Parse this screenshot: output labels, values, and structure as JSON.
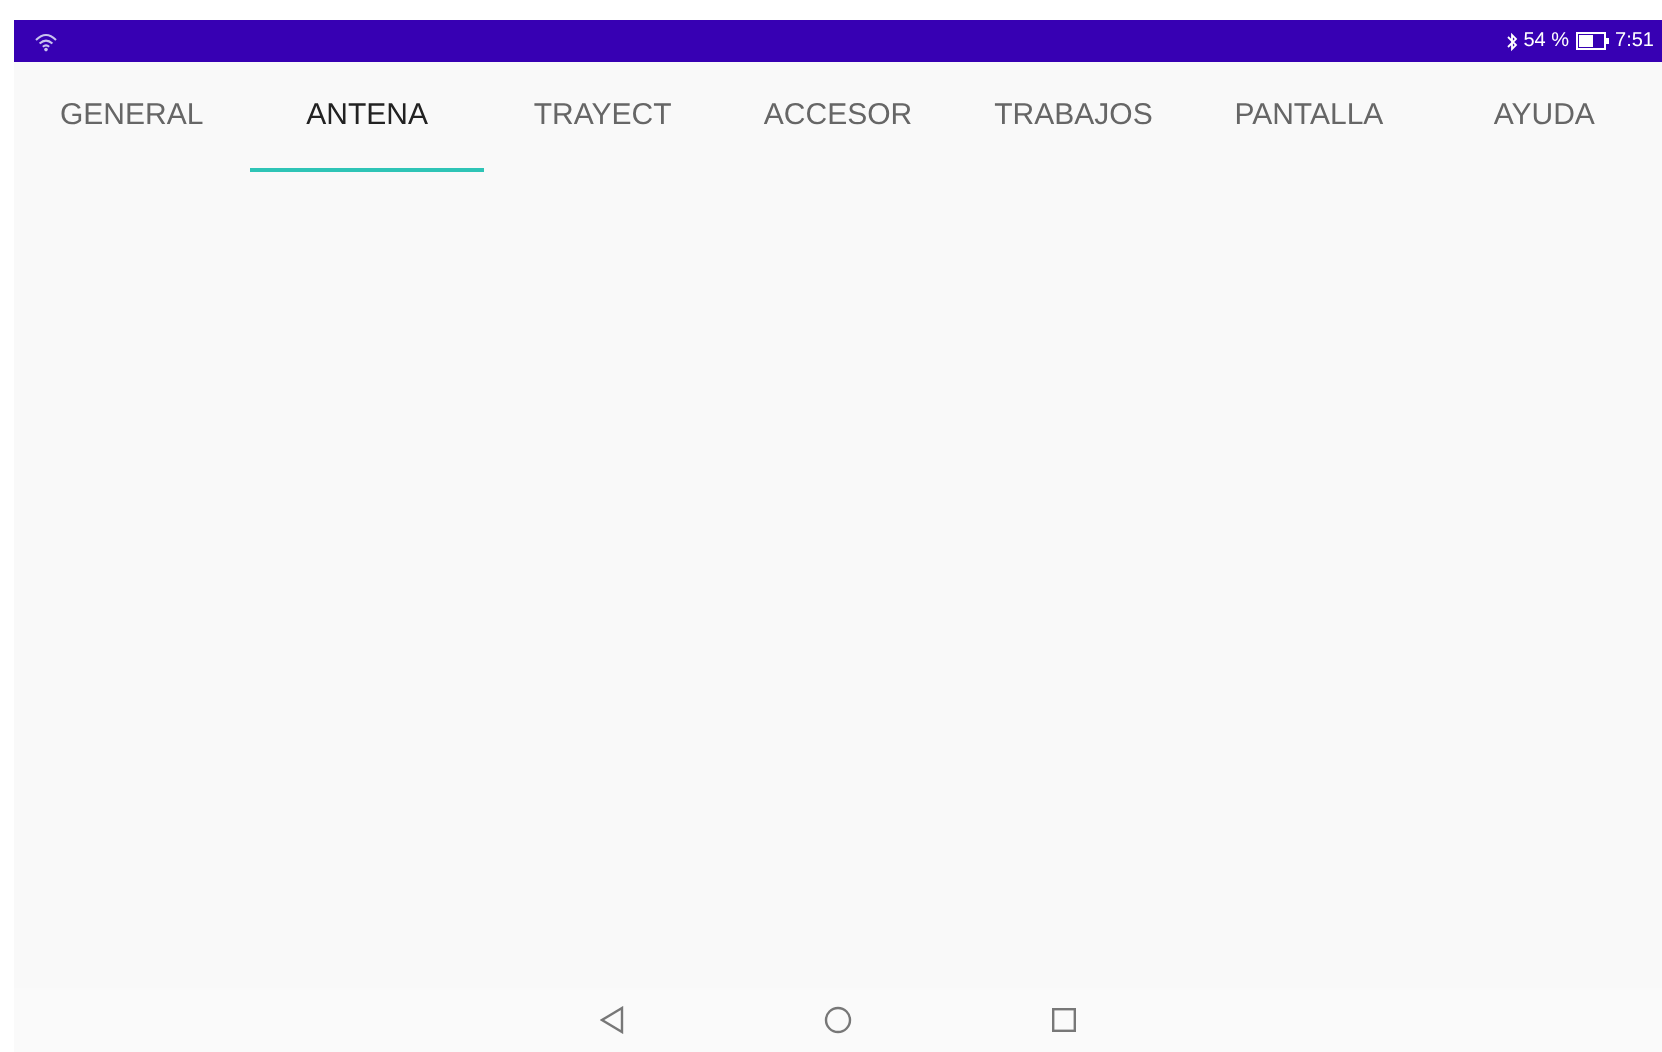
{
  "status_bar": {
    "battery_text": "54 %",
    "time": "7:51"
  },
  "tabs": [
    {
      "label": "GENERAL",
      "selected": false
    },
    {
      "label": "ANTENA",
      "selected": true
    },
    {
      "label": "TRAYECT",
      "selected": false
    },
    {
      "label": "ACCESOR",
      "selected": false
    },
    {
      "label": "TRABAJOS",
      "selected": false
    },
    {
      "label": "PANTALLA",
      "selected": false
    },
    {
      "label": "AYUDA",
      "selected": false
    }
  ]
}
